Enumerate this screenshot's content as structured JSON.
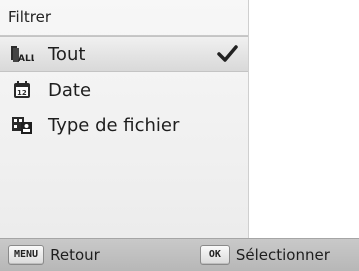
{
  "menu": {
    "title": "Filtrer",
    "items": [
      {
        "label": "Tout",
        "icon": "all-files-icon",
        "selected": true
      },
      {
        "label": "Date",
        "icon": "calendar-icon",
        "selected": false
      },
      {
        "label": "Type de fichier",
        "icon": "file-type-icon",
        "selected": false
      }
    ]
  },
  "bottombar": {
    "back_key": "MENU",
    "back_label": "Retour",
    "select_key": "OK",
    "select_label": "Sélectionner"
  },
  "colors": {
    "selected_row": "#d9d9d9",
    "bottombar": "#c2c2c2",
    "checkmark": "#222222"
  }
}
